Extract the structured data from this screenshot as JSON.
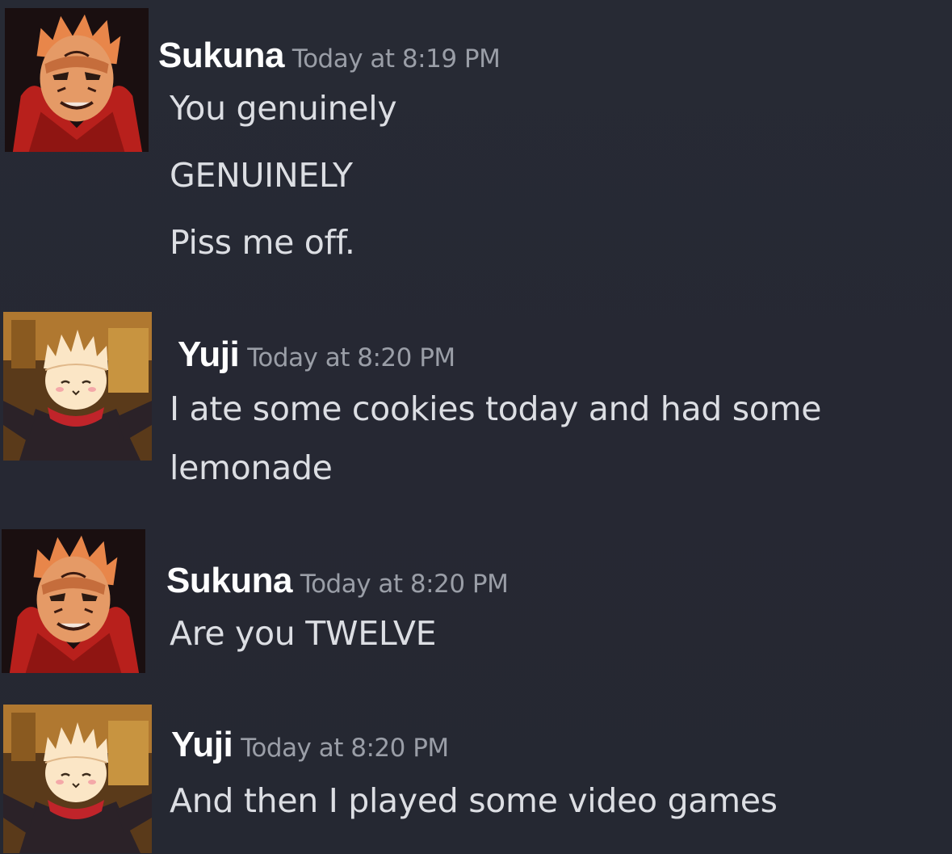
{
  "messages": [
    {
      "username": "Sukuna",
      "timestamp": "Today at 8:19 PM",
      "avatar": "sukuna-avatar",
      "lines": [
        "You genuinely",
        "GENUINELY",
        "Piss me off."
      ]
    },
    {
      "username": "Yuji",
      "timestamp": "Today at 8:20 PM",
      "avatar": "yuji-avatar",
      "lines": [
        "I ate some cookies today and had some",
        "lemonade"
      ]
    },
    {
      "username": "Sukuna",
      "timestamp": "Today at 8:20 PM",
      "avatar": "sukuna-avatar",
      "lines": [
        "Are you TWELVE"
      ]
    },
    {
      "username": "Yuji",
      "timestamp": "Today at 8:20 PM",
      "avatar": "yuji-avatar",
      "lines": [
        "And then I played some video games"
      ]
    }
  ],
  "colors": {
    "background": "#262832",
    "username": "#ffffff",
    "timestamp": "#9a9ea7",
    "message_text": "#dcdee3"
  }
}
